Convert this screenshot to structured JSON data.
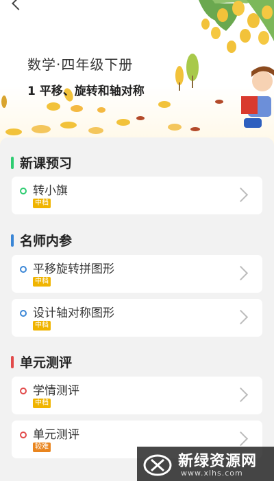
{
  "header": {
    "subject": "数学·四年级下册",
    "unit_title": "1 平移、旋转和轴对称"
  },
  "sections": [
    {
      "title": "新课预习",
      "accent": "#2ecc71",
      "items": [
        {
          "label": "转小旗",
          "level": "中档"
        }
      ]
    },
    {
      "title": "名师内参",
      "accent": "#3a86d6",
      "items": [
        {
          "label": "平移旋转拼图形",
          "level": "中档"
        },
        {
          "label": "设计轴对称图形",
          "level": "中档"
        }
      ]
    },
    {
      "title": "单元测评",
      "accent": "#e24a4a",
      "items": [
        {
          "label": "学情测评",
          "level": "中档"
        },
        {
          "label": "单元测评",
          "level": "较难"
        }
      ]
    }
  ],
  "badge_colors": {
    "中档": "#f0b400",
    "较难": "#e9851f"
  },
  "watermark": {
    "name": "新绿资源网",
    "url": "www.xlhs.com"
  }
}
